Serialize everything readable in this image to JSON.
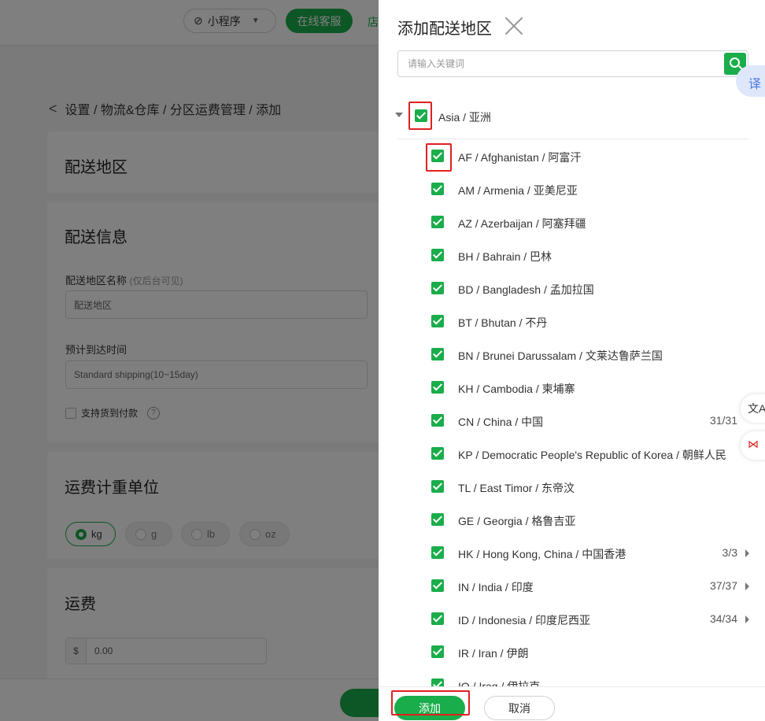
{
  "topbar": {
    "mini_program_label": "小程序",
    "service_label": "在线客服",
    "store_label": "店"
  },
  "breadcrumb": {
    "back": "<",
    "text": "设置 / 物流&仓库 / 分区运费管理 / 添加"
  },
  "sections": {
    "zone_title": "配送地区",
    "info_title": "配送信息",
    "zone_name_label": "配送地区名称",
    "zone_name_hint": "(仅后台可见)",
    "zone_name_value": "配送地区",
    "eta_label": "预计到达时间",
    "eta_value": "Standard shipping(10~15day)",
    "cod_label": "支持货到付款",
    "cod_help": "?",
    "weight_unit_title": "运费计重单位",
    "units": [
      "kg",
      "g",
      "lb",
      "oz"
    ],
    "selected_unit": "kg",
    "fee_title": "运费",
    "fee_currency": "$",
    "fee_value": "0.00"
  },
  "drawer": {
    "title": "添加配送地区",
    "search_placeholder": "请输入关键词",
    "translate_label": "译",
    "continent": "Asia / 亚洲",
    "countries": [
      {
        "name": "AF / Afghanistan / 阿富汗",
        "count": "",
        "expandable": false
      },
      {
        "name": "AM / Armenia / 亚美尼亚",
        "count": "",
        "expandable": false
      },
      {
        "name": "AZ / Azerbaijan / 阿塞拜疆",
        "count": "",
        "expandable": false
      },
      {
        "name": "BH / Bahrain / 巴林",
        "count": "",
        "expandable": false
      },
      {
        "name": "BD / Bangladesh / 孟加拉国",
        "count": "",
        "expandable": false
      },
      {
        "name": "BT / Bhutan / 不丹",
        "count": "",
        "expandable": false
      },
      {
        "name": "BN / Brunei Darussalam / 文莱达鲁萨兰国",
        "count": "",
        "expandable": false
      },
      {
        "name": "KH / Cambodia / 柬埔寨",
        "count": "",
        "expandable": false
      },
      {
        "name": "CN / China / 中国",
        "count": "31/31",
        "expandable": false
      },
      {
        "name": "KP / Democratic People's Republic of Korea / 朝鲜人民",
        "count": "",
        "expandable": false
      },
      {
        "name": "TL / East Timor / 东帝汶",
        "count": "",
        "expandable": false
      },
      {
        "name": "GE / Georgia / 格鲁吉亚",
        "count": "",
        "expandable": false
      },
      {
        "name": "HK / Hong Kong, China / 中国香港",
        "count": "3/3",
        "expandable": true
      },
      {
        "name": "IN / India / 印度",
        "count": "37/37",
        "expandable": true
      },
      {
        "name": "ID / Indonesia / 印度尼西亚",
        "count": "34/34",
        "expandable": true
      },
      {
        "name": "IR / Iran / 伊朗",
        "count": "",
        "expandable": false
      },
      {
        "name": "IQ / Iraq / 伊拉克",
        "count": "",
        "expandable": false
      }
    ],
    "add_label": "添加",
    "cancel_label": "取消"
  },
  "side_tools": {
    "translate_icon": "文A",
    "network_icon": "⋈"
  },
  "colors": {
    "accent": "#1aad4b",
    "highlight": "#e02020"
  }
}
